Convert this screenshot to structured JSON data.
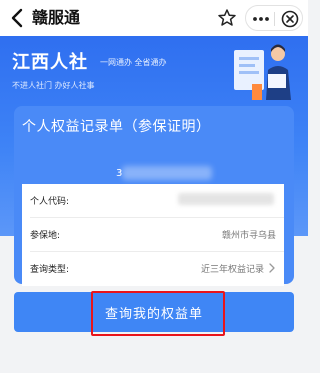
{
  "nav": {
    "title": "赣服通",
    "back_icon": "back-icon",
    "star_icon": "star-icon",
    "more_icon": "more-icon",
    "close_icon": "close-icon"
  },
  "banner": {
    "brand": "江西人社",
    "tagline": "一网通办 全省通办",
    "slogan": "不进人社门 办好人社事",
    "illustration": "person-with-document-illustration"
  },
  "card": {
    "title": "个人权益记录单（参保证明）",
    "partial_number": "3"
  },
  "info_rows": [
    {
      "label": "个人代码:",
      "value": ""
    },
    {
      "label": "参保地:",
      "value": "赣州市寻乌县"
    },
    {
      "label": "查询类型:",
      "value": "近三年权益记录"
    }
  ],
  "query_button": {
    "label": "查询我的权益单"
  },
  "colors": {
    "primary": "#3f86f5",
    "highlight": "#e8141b"
  }
}
